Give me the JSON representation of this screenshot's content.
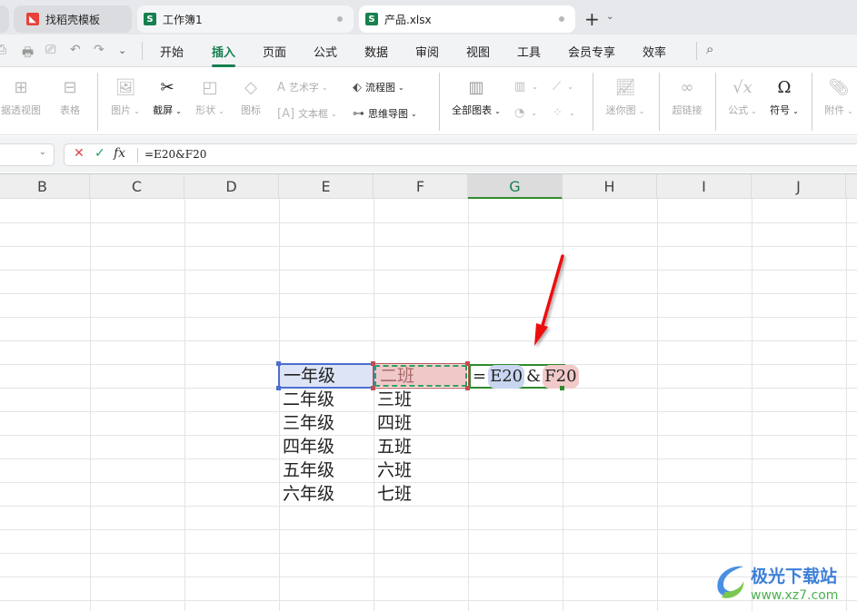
{
  "tabs": [
    {
      "label": "",
      "icon": "app-icon"
    },
    {
      "label": "找稻壳模板",
      "icon": "docer-icon",
      "icon_color": "#e8403a"
    },
    {
      "label": "工作簿1",
      "icon": "spreadsheet-icon",
      "icon_glyph": "S",
      "icon_color": "#17804f"
    },
    {
      "label": "产品.xlsx",
      "icon": "spreadsheet-icon",
      "icon_glyph": "S",
      "icon_color": "#17804f"
    }
  ],
  "new_tab": "+",
  "menu": {
    "items": [
      "开始",
      "插入",
      "页面",
      "公式",
      "数据",
      "审阅",
      "视图",
      "工具",
      "会员专享",
      "效率"
    ],
    "active": "插入",
    "accent": "#17804f"
  },
  "ribbon": {
    "large_buttons": [
      {
        "label": "据透视图",
        "icon": "pivot-chart-icon",
        "enabled": false
      },
      {
        "label": "表格",
        "icon": "table-icon",
        "enabled": false
      },
      {
        "label": "图片",
        "icon": "picture-icon",
        "enabled": false,
        "dropdown": true
      },
      {
        "label": "截屏",
        "icon": "screenshot-icon",
        "enabled": true,
        "dropdown": true
      },
      {
        "label": "形状",
        "icon": "shapes-icon",
        "enabled": false,
        "dropdown": true
      },
      {
        "label": "图标",
        "icon": "icons-icon",
        "enabled": false
      },
      {
        "label": "全部图表",
        "icon": "all-charts-icon",
        "enabled": true,
        "dropdown": true
      },
      {
        "label": "迷你图",
        "icon": "sparkline-icon",
        "enabled": false,
        "dropdown": true
      },
      {
        "label": "超链接",
        "icon": "hyperlink-icon",
        "enabled": false
      },
      {
        "label": "公式",
        "icon": "equation-icon",
        "enabled": false,
        "dropdown": true
      },
      {
        "label": "符号",
        "icon": "omega-icon",
        "enabled": true,
        "dropdown": true
      },
      {
        "label": "附件",
        "icon": "attachment-icon",
        "enabled": false,
        "dropdown": true
      }
    ],
    "small_buttons": [
      {
        "label": "艺术字",
        "icon": "wordart-icon",
        "enabled": false
      },
      {
        "label": "文本框",
        "icon": "textbox-icon",
        "enabled": false
      },
      {
        "label": "流程图",
        "icon": "flowchart-icon",
        "enabled": true
      },
      {
        "label": "思维导图",
        "icon": "mindmap-icon",
        "enabled": true
      }
    ]
  },
  "formula_bar": {
    "name_box": "",
    "formula": "=E20&F20"
  },
  "columns": [
    "B",
    "C",
    "D",
    "E",
    "F",
    "G",
    "H",
    "I",
    "J"
  ],
  "active_column": "G",
  "cells": {
    "E": [
      "一年级",
      "二年级",
      "三年级",
      "四年级",
      "五年级",
      "六年级"
    ],
    "F": [
      "二班",
      "三班",
      "四班",
      "五班",
      "六班",
      "七班"
    ]
  },
  "editing_cell": {
    "prefix": "=",
    "ref1": "E20",
    "operator": "&",
    "ref2": "F20"
  },
  "colors": {
    "ref1_highlight": "#4a6fcf",
    "ref2_highlight": "#c05050",
    "active_cell_border": "#2e8b2e",
    "annotation_arrow": "#ee1111"
  },
  "watermark": {
    "title": "极光下载站",
    "url": "www.xz7.com"
  }
}
